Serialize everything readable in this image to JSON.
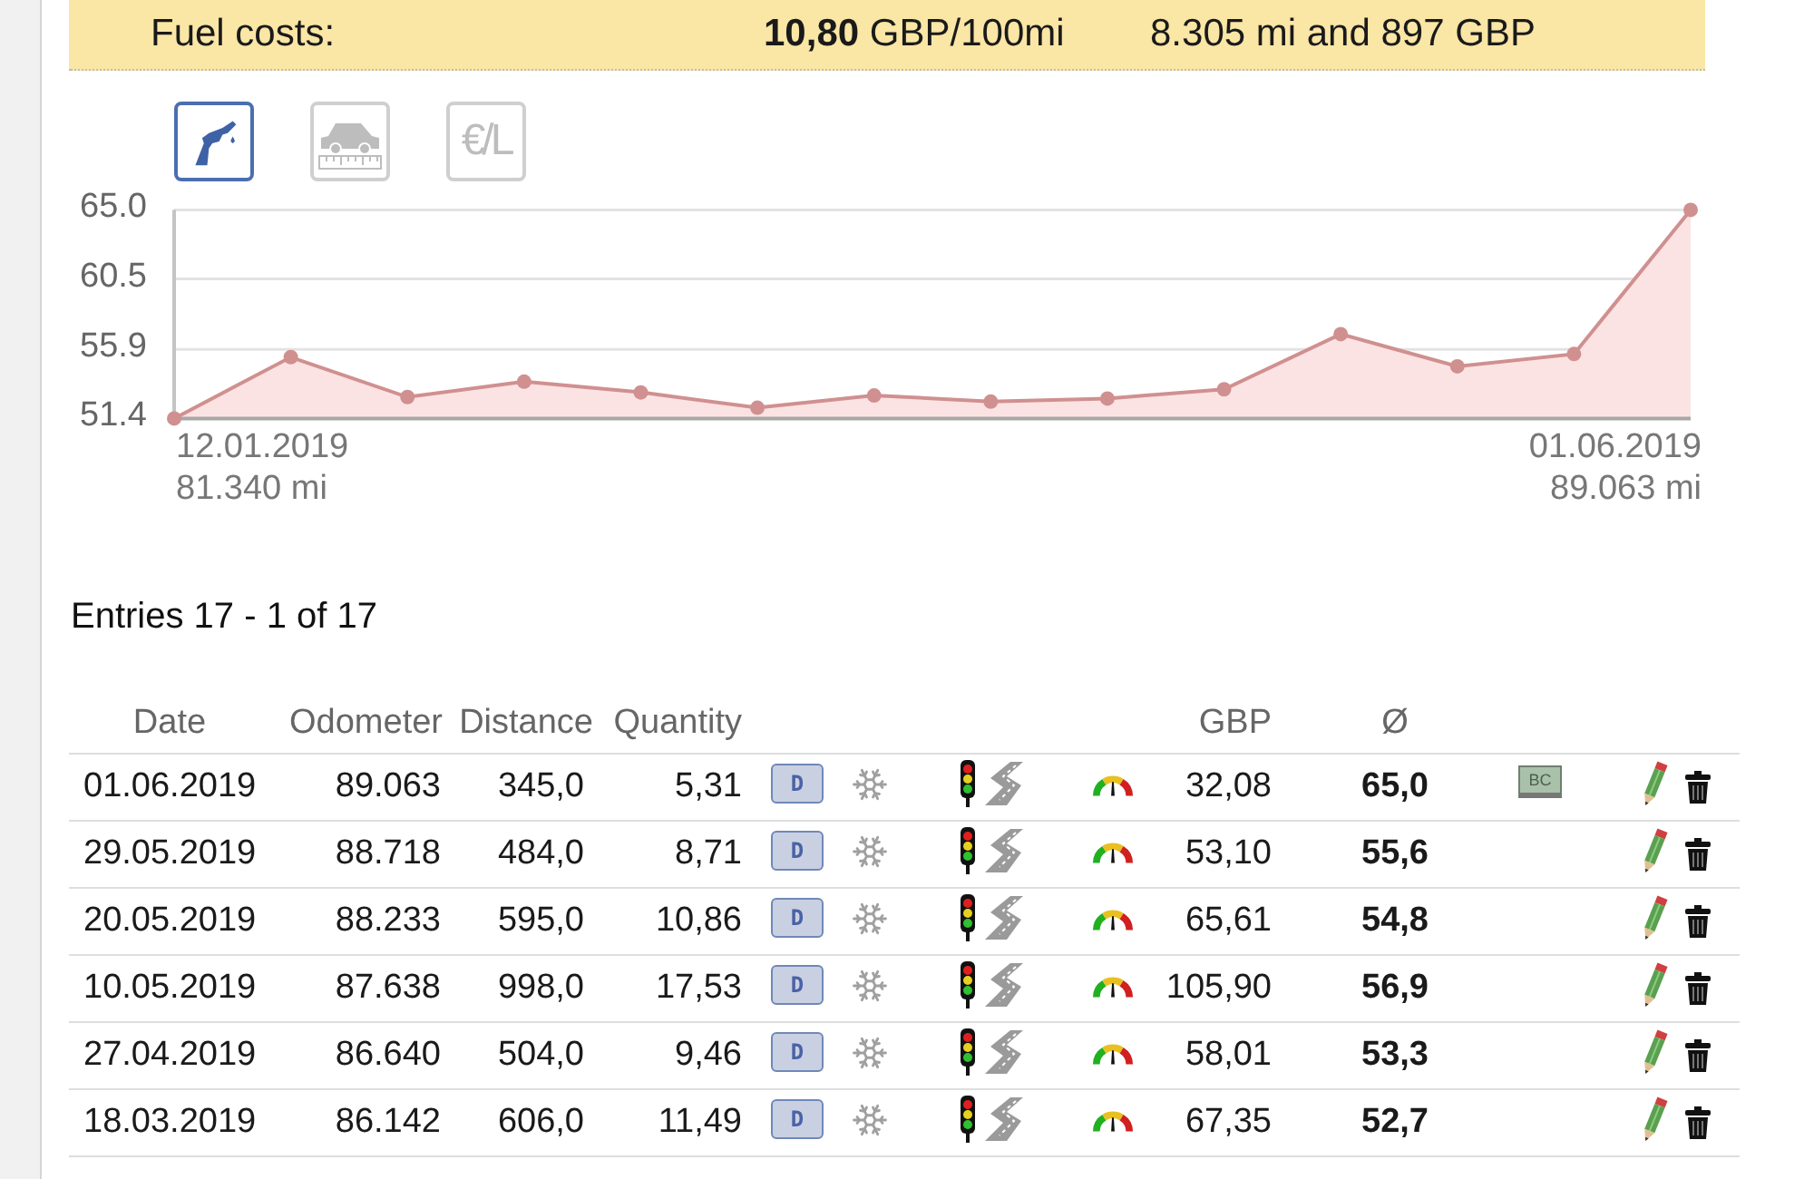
{
  "summary_bar": {
    "label": "Fuel costs:",
    "cost_per_distance": "**10,80** GBP/100mi",
    "totals": "8.305 mi and 897 GBP"
  },
  "chart_modes": [
    {
      "kind": "fuel",
      "selected": true
    },
    {
      "kind": "distance",
      "selected": false
    },
    {
      "kind": "price",
      "label": "€/L",
      "selected": false
    }
  ],
  "chart": {
    "chart_data": {
      "type": "area",
      "values": [
        51.4,
        55.4,
        52.8,
        53.8,
        53.1,
        52.1,
        52.9,
        52.5,
        52.7,
        53.3,
        56.9,
        54.8,
        55.6,
        65.0
      ],
      "ylim": [
        51.4,
        65.0
      ],
      "yticks": [
        {
          "value": 65.0,
          "label": "65.0"
        },
        {
          "value": 60.5,
          "label": "60.5"
        },
        {
          "value": 55.9,
          "label": "55.9"
        },
        {
          "value": 51.4,
          "label": "51.4"
        }
      ]
    },
    "range_labels": [
      {
        "date": "12.01.2019",
        "odometer": "81.340 mi"
      },
      {
        "date": "01.06.2019",
        "odometer": "89.063 mi"
      }
    ]
  },
  "entries_caption": "Entries 17 - 1 of 17",
  "table": {
    "columns": [
      "Date",
      "Odometer",
      "Distance",
      "Quantity",
      "GBP",
      "Ø"
    ],
    "rows": [
      {
        "date": "01.06.2019",
        "odometer": "89.063",
        "distance": "345,0",
        "quantity": "5,31",
        "fuel_type": "D",
        "gbp": "32,08",
        "consumption": "65,0",
        "trip_computer": "BC"
      },
      {
        "date": "29.05.2019",
        "odometer": "88.718",
        "distance": "484,0",
        "quantity": "8,71",
        "fuel_type": "D",
        "gbp": "53,10",
        "consumption": "55,6"
      },
      {
        "date": "20.05.2019",
        "odometer": "88.233",
        "distance": "595,0",
        "quantity": "10,86",
        "fuel_type": "D",
        "gbp": "65,61",
        "consumption": "54,8"
      },
      {
        "date": "10.05.2019",
        "odometer": "87.638",
        "distance": "998,0",
        "quantity": "17,53",
        "fuel_type": "D",
        "gbp": "105,90",
        "consumption": "56,9"
      },
      {
        "date": "27.04.2019",
        "odometer": "86.640",
        "distance": "504,0",
        "quantity": "9,46",
        "fuel_type": "D",
        "gbp": "58,01",
        "consumption": "53,3"
      },
      {
        "date": "18.03.2019",
        "odometer": "86.142",
        "distance": "606,0",
        "quantity": "11,49",
        "fuel_type": "D",
        "gbp": "67,35",
        "consumption": "52,7"
      }
    ]
  }
}
